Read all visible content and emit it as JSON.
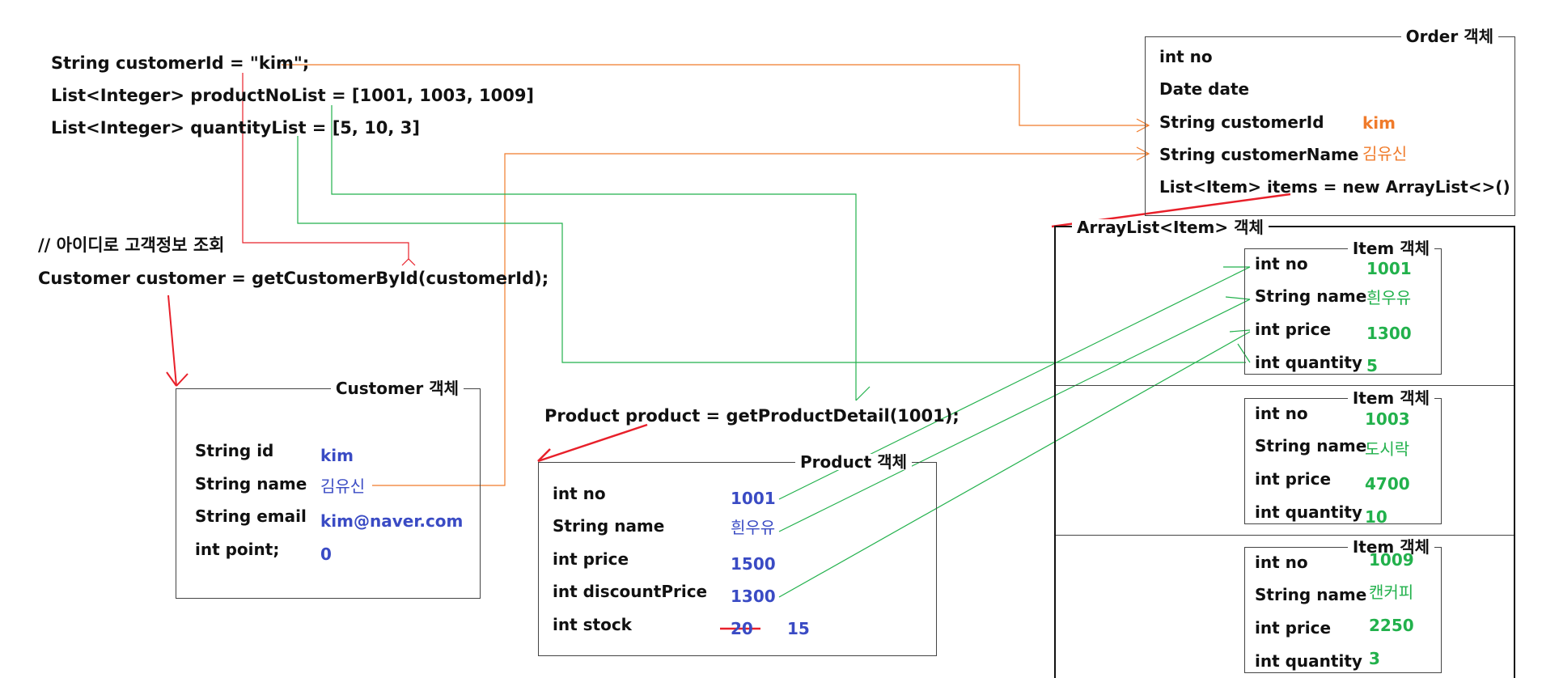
{
  "code": {
    "line1": "String customerId = \"kim\";",
    "line2": "List<Integer> productNoList = [1001, 1003, 1009]",
    "line3": "List<Integer> quantityList = [5, 10, 3]",
    "comment": "// 아이디로 고객정보 조회",
    "customer_call": "Customer customer = getCustomerById(customerId);",
    "product_call": "Product product = getProductDetail(1001);"
  },
  "customer": {
    "title": "Customer 객체",
    "fields": [
      {
        "label": "String id",
        "value": "kim"
      },
      {
        "label": "String name",
        "value": "김유신"
      },
      {
        "label": "String email",
        "value": "kim@naver.com"
      },
      {
        "label": "int point;",
        "value": "0"
      }
    ]
  },
  "product": {
    "title": "Product 객체",
    "fields": [
      {
        "label": "int no",
        "value": "1001"
      },
      {
        "label": "String name",
        "value": "흰우유"
      },
      {
        "label": "int price",
        "value": "1500"
      },
      {
        "label": "int discountPrice",
        "value": "1300"
      },
      {
        "label": "int stock",
        "value": "20",
        "new_value": "15"
      }
    ]
  },
  "order": {
    "title": "Order 객체",
    "fields": [
      {
        "label": "int no",
        "value": ""
      },
      {
        "label": "Date date",
        "value": ""
      },
      {
        "label": "String customerId",
        "value": "kim"
      },
      {
        "label": "String customerName",
        "value": "김유신"
      },
      {
        "label": "List<Item> items = new ArrayList<>()",
        "value": ""
      }
    ]
  },
  "arraylist": {
    "title": "ArrayList<Item> 객체",
    "items": [
      {
        "title": "Item 객체",
        "no": "1001",
        "name": "흰우유",
        "price": "1300",
        "quantity": "5"
      },
      {
        "title": "Item 객체",
        "no": "1003",
        "name": "도시락",
        "price": "4700",
        "quantity": "10"
      },
      {
        "title": "Item 객체",
        "no": "1009",
        "name": "캔커피",
        "price": "2250",
        "quantity": "3"
      }
    ],
    "labels": {
      "no": "int no",
      "name": "String name",
      "price": "int price",
      "quantity": "int quantity"
    }
  },
  "colors": {
    "orange": "#f07b2b",
    "green": "#22b14c",
    "red": "#e8202a",
    "blue": "#3a4bc4"
  }
}
